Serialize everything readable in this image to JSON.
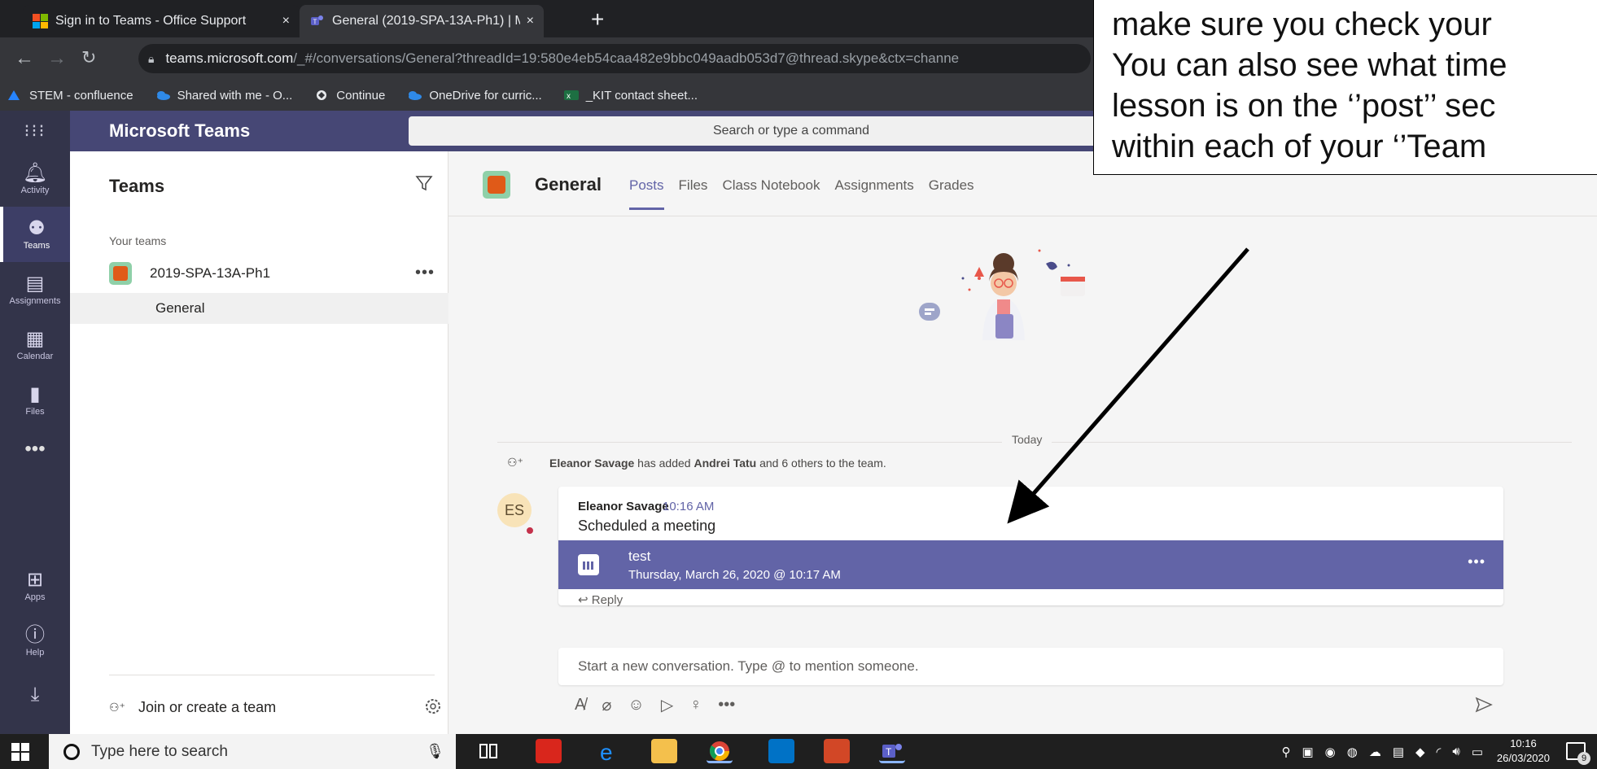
{
  "browser": {
    "tabs": [
      {
        "title": "Sign in to Teams - Office Support",
        "close": "×"
      },
      {
        "title": "General (2019-SPA-13A-Ph1) | M",
        "close": "×"
      }
    ],
    "new_tab": "+",
    "url_host": "teams.microsoft.com",
    "url_rest": "/_#/conversations/General?threadId=19:580e4eb54caa482e9bbc049aadb053d7@thread.skype&ctx=channe",
    "bookmarks": [
      {
        "label": "STEM - confluence",
        "icon": "confluence-icon"
      },
      {
        "label": "Shared with me - O...",
        "icon": "onedrive-icon"
      },
      {
        "label": "Continue",
        "icon": "globe-icon"
      },
      {
        "label": "OneDrive for curric...",
        "icon": "onedrive-icon"
      },
      {
        "label": "_KIT contact sheet...",
        "icon": "excel-icon"
      }
    ]
  },
  "teams": {
    "app_name": "Microsoft Teams",
    "search_placeholder": "Search or type a command",
    "rail": [
      {
        "label": "Activity",
        "icon": "bell-icon"
      },
      {
        "label": "Teams",
        "icon": "teams-icon"
      },
      {
        "label": "Assignments",
        "icon": "assignments-icon"
      },
      {
        "label": "Calendar",
        "icon": "calendar-icon"
      },
      {
        "label": "Files",
        "icon": "file-icon"
      },
      {
        "label": "Apps",
        "icon": "apps-icon"
      },
      {
        "label": "Help",
        "icon": "help-icon"
      }
    ],
    "rail_more": "•••",
    "left_pane": {
      "title": "Teams",
      "section": "Your teams",
      "team_name": "2019-SPA-13A-Ph1",
      "team_more": "•••",
      "channel": "General",
      "join_label": "Join or create a team"
    },
    "channel": {
      "name": "General",
      "tabs": [
        "Posts",
        "Files",
        "Class Notebook",
        "Assignments",
        "Grades"
      ]
    },
    "feed": {
      "date_divider": "Today",
      "system_actor": "Eleanor Savage",
      "system_mid": "has added",
      "system_target": "Andrei Tatu",
      "system_tail": "and 6 others to the team.",
      "message": {
        "initials": "ES",
        "author": "Eleanor Savage",
        "time": "10:16 AM",
        "text": "Scheduled a meeting",
        "meeting_title": "test",
        "meeting_date": "Thursday, March 26, 2020 @ 10:17 AM",
        "meeting_more": "•••",
        "reply": "↩ Reply"
      },
      "composer_placeholder": "Start a new conversation. Type @ to mention someone."
    }
  },
  "callout": {
    "lines": [
      "make sure you check your",
      "You can also see what time",
      "lesson is on the ‘’post’’ sec",
      "within each of your ‘’Team"
    ]
  },
  "taskbar": {
    "search_placeholder": "Type here to search",
    "time": "10:16",
    "date": "26/03/2020",
    "notification_count": "9"
  },
  "colors": {
    "teams_purple": "#6264a7",
    "rail_bg": "#33344a",
    "topbar_bg": "#464775"
  }
}
